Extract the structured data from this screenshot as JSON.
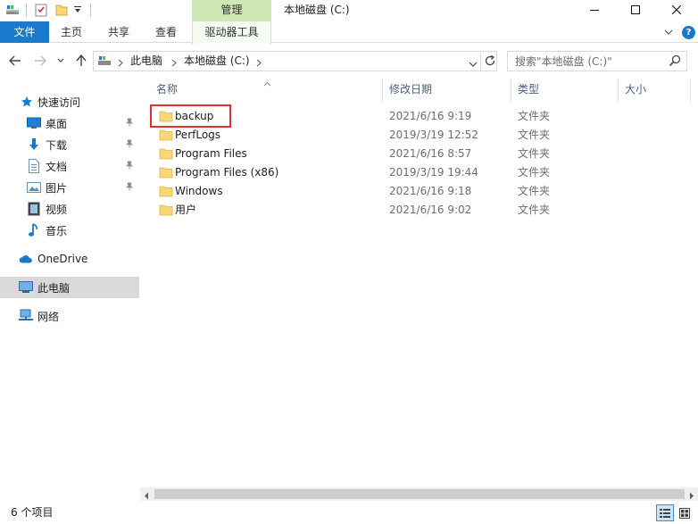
{
  "window": {
    "title": "本地磁盘 (C:)",
    "context_tab_group": "管理",
    "controls": {
      "minimize": "minimize",
      "maximize": "maximize",
      "close": "close"
    }
  },
  "ribbon": {
    "file_tab": "文件",
    "tabs": [
      "主页",
      "共享",
      "查看"
    ],
    "context_tab": "驱动器工具",
    "help": "?"
  },
  "address": {
    "crumbs": [
      "此电脑",
      "本地磁盘 (C:)"
    ]
  },
  "search": {
    "placeholder": "搜索\"本地磁盘 (C:)\""
  },
  "nav": {
    "quick_access": "快速访问",
    "items": [
      {
        "label": "桌面",
        "icon": "desktop-icon",
        "pinned": true
      },
      {
        "label": "下载",
        "icon": "download-icon",
        "pinned": true
      },
      {
        "label": "文档",
        "icon": "documents-icon",
        "pinned": true
      },
      {
        "label": "图片",
        "icon": "pictures-icon",
        "pinned": true
      },
      {
        "label": "视频",
        "icon": "videos-icon",
        "pinned": false
      },
      {
        "label": "音乐",
        "icon": "music-icon",
        "pinned": false
      }
    ],
    "onedrive": "OneDrive",
    "this_pc": "此电脑",
    "network": "网络"
  },
  "columns": {
    "name": "名称",
    "date": "修改日期",
    "type": "类型",
    "size": "大小"
  },
  "files": [
    {
      "name": "backup",
      "date": "2021/6/16 9:19",
      "type": "文件夹"
    },
    {
      "name": "PerfLogs",
      "date": "2019/3/19 12:52",
      "type": "文件夹"
    },
    {
      "name": "Program Files",
      "date": "2021/6/16 8:57",
      "type": "文件夹"
    },
    {
      "name": "Program Files (x86)",
      "date": "2019/3/19 19:44",
      "type": "文件夹"
    },
    {
      "name": "Windows",
      "date": "2021/6/16 9:18",
      "type": "文件夹"
    },
    {
      "name": "用户",
      "date": "2021/6/16 9:02",
      "type": "文件夹"
    }
  ],
  "status": {
    "count": "6 个项目"
  },
  "colors": {
    "accent": "#1979ca",
    "manage_tab": "#cfe9b4",
    "highlight_border": "#e03030",
    "folder": "#f8d775"
  }
}
